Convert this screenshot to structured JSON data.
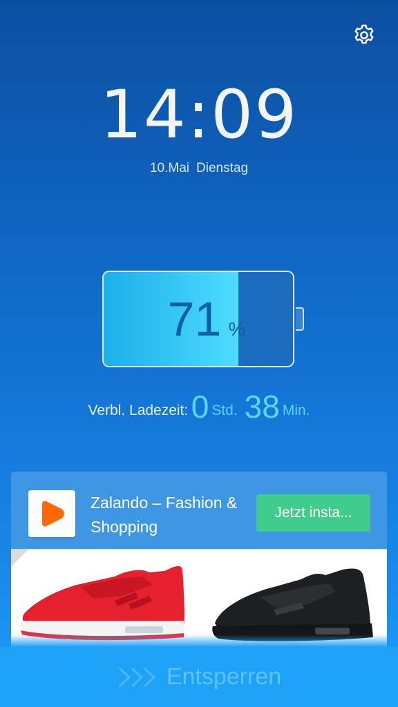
{
  "clock": {
    "hours": "14",
    "separator": ":",
    "minutes": "09"
  },
  "date": {
    "day": "10.Mai",
    "weekday": "Dienstag"
  },
  "battery": {
    "level": 71,
    "level_text": "71",
    "unit": "%"
  },
  "charging": {
    "label": "Verbl. Ladezeit:",
    "hours": "0",
    "hours_unit": "Std.",
    "minutes": "38",
    "minutes_unit": "Min."
  },
  "ad": {
    "app_title": "Zalando – Fashion & Shopping",
    "cta_label": "Jetzt insta..."
  },
  "unlock": {
    "label": "Entsperren"
  },
  "colors": {
    "accent_cyan": "#59d6ff",
    "cta_green": "#3fcc8c",
    "zalando_orange": "#ff6900"
  },
  "icons": {
    "settings": "gear-icon",
    "app": "zalando-play-logo",
    "unlock": "chevrons-right-icon"
  }
}
